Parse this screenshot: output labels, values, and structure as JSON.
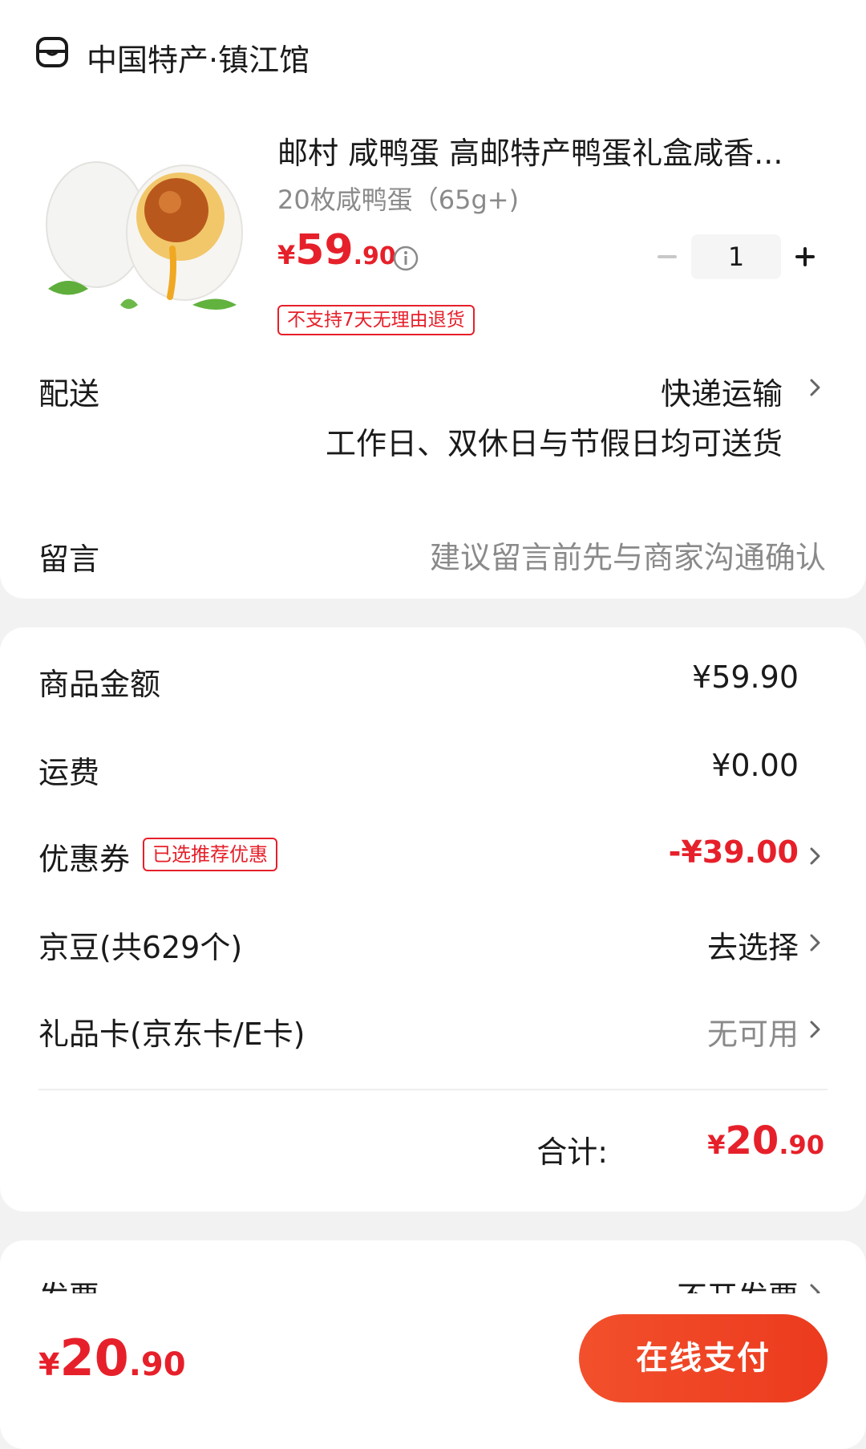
{
  "shop": {
    "name": "中国特产·镇江馆",
    "icon": "shop-icon"
  },
  "product": {
    "title": "邮村 咸鸭蛋 高邮特产鸭蛋礼盒咸香...",
    "spec": "20枚咸鸭蛋（65g+)",
    "price_currency": "¥",
    "price_int": "59",
    "price_dec": ".90",
    "quantity": "1",
    "return_badge": "不支持7天无理由退货",
    "image": "salted-duck-egg-image"
  },
  "delivery": {
    "label": "配送",
    "method": "快递运输",
    "note": "工作日、双休日与节假日均可送货"
  },
  "message": {
    "label": "留言",
    "placeholder": "建议留言前先与商家沟通确认"
  },
  "summary": {
    "goods_amount_label": "商品金额",
    "goods_amount_value": "¥59.90",
    "shipping_label": "运费",
    "shipping_value": "¥0.00",
    "coupon_label": "优惠券",
    "coupon_badge": "已选推荐优惠",
    "coupon_value": "-¥39.00",
    "beans_label": "京豆(共629个)",
    "beans_value": "去选择",
    "giftcard_label": "礼品卡(京东卡/E卡)",
    "giftcard_value": "无可用",
    "total_label": "合计:",
    "total_currency": "¥",
    "total_int": "20",
    "total_dec": ".90"
  },
  "invoice": {
    "label": "发票",
    "value": "不开发票"
  },
  "bottom": {
    "currency": "¥",
    "int": "20",
    "dec": ".90",
    "pay_label": "在线支付"
  },
  "colors": {
    "accent_red": "#e6202a",
    "pay_button": "#ef4424",
    "background": "#f2f2f2"
  }
}
